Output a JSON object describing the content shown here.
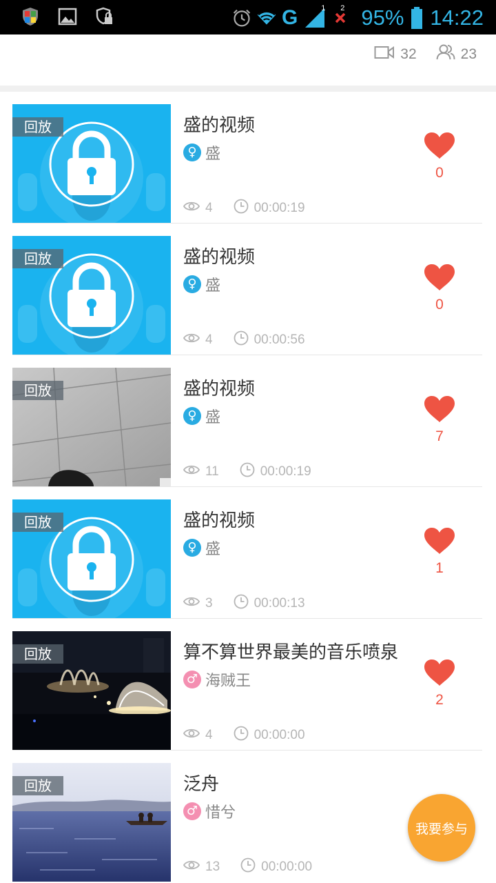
{
  "status_bar": {
    "signal_badges": [
      "1",
      "2"
    ],
    "network": "G",
    "battery": "95%",
    "time": "14:22"
  },
  "header": {
    "videos_count": "32",
    "users_count": "23"
  },
  "items": [
    {
      "thumb": "locked",
      "badge": "回放",
      "title": "盛的视频",
      "gender": "female",
      "gender_symbol": "♀",
      "author": "盛",
      "views": "4",
      "duration": "00:00:19",
      "likes": "0"
    },
    {
      "thumb": "locked",
      "badge": "回放",
      "title": "盛的视频",
      "gender": "female",
      "gender_symbol": "♀",
      "author": "盛",
      "views": "4",
      "duration": "00:00:56",
      "likes": "0"
    },
    {
      "thumb": "ceiling",
      "badge": "回放",
      "title": "盛的视频",
      "gender": "female",
      "gender_symbol": "♀",
      "author": "盛",
      "views": "11",
      "duration": "00:00:19",
      "likes": "7"
    },
    {
      "thumb": "locked",
      "badge": "回放",
      "title": "盛的视频",
      "gender": "female",
      "gender_symbol": "♀",
      "author": "盛",
      "views": "3",
      "duration": "00:00:13",
      "likes": "1"
    },
    {
      "thumb": "fountain",
      "badge": "回放",
      "title": "算不算世界最美的音乐喷泉",
      "gender": "male",
      "gender_symbol": "♂",
      "author": "海贼王",
      "views": "4",
      "duration": "00:00:00",
      "likes": "2"
    },
    {
      "thumb": "lake",
      "badge": "回放",
      "title": "泛舟",
      "gender": "male",
      "gender_symbol": "♂",
      "author": "惜兮",
      "views": "13",
      "duration": "00:00:00",
      "likes": ""
    }
  ],
  "fab_label": "我要参与",
  "colors": {
    "accent_blue": "#33b5e5",
    "heart_red": "#ee5443",
    "fab_orange": "#f9a531",
    "thumb_blue": "#1ab3ef"
  }
}
